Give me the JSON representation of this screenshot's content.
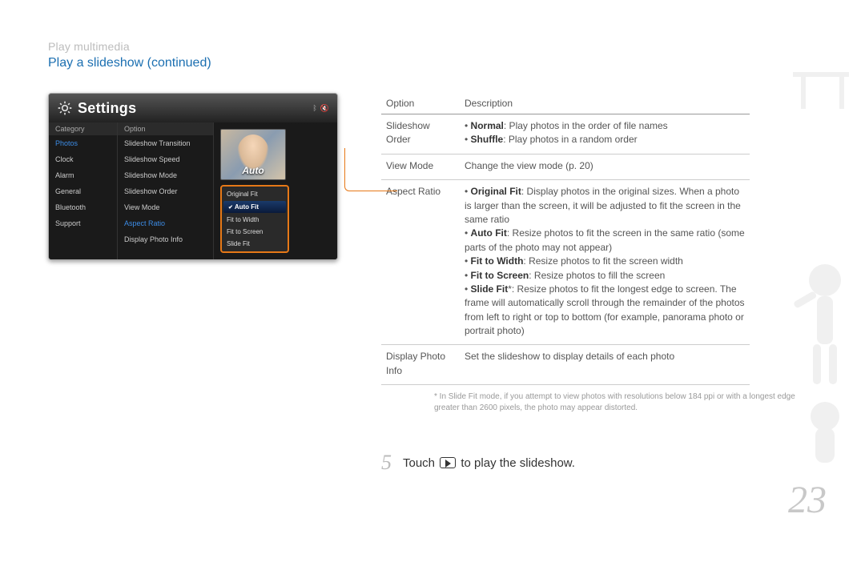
{
  "breadcrumb": "Play multimedia",
  "section_title": "Play a slideshow  (continued)",
  "settings": {
    "title": "Settings",
    "header_icons": [
      "bt-icon",
      "speaker-icon"
    ],
    "cat_heading": "Category",
    "opt_heading": "Option",
    "categories": [
      "Photos",
      "Clock",
      "Alarm",
      "General",
      "Bluetooth",
      "Support"
    ],
    "options": [
      "Slideshow Transition",
      "Slideshow Speed",
      "Slideshow Mode",
      "Slideshow Order",
      "View Mode",
      "Aspect Ratio",
      "Display Photo Info"
    ],
    "preview_label": "Auto",
    "popup": [
      "Original Fit",
      "Auto Fit",
      "Fit to Width",
      "Fit to Screen",
      "Slide Fit"
    ],
    "popup_selected": "Auto Fit"
  },
  "table": {
    "head_option": "Option",
    "head_desc": "Description",
    "rows": [
      {
        "option": "Slideshow Order",
        "items": [
          {
            "b": "Normal",
            "t": ": Play photos in the order of file names"
          },
          {
            "b": "Shuffle",
            "t": ": Play photos in a random order"
          }
        ]
      },
      {
        "option": "View Mode",
        "plain": "Change the view mode (p. 20)"
      },
      {
        "option": "Aspect Ratio",
        "items": [
          {
            "b": "Original Fit",
            "t": ": Display photos in the original sizes. When a photo is larger than the screen, it will be adjusted to fit the screen in the same ratio"
          },
          {
            "b": "Auto Fit",
            "t": ": Resize photos to fit the screen in the same ratio (some parts of the photo may not appear)"
          },
          {
            "b": "Fit to Width",
            "t": ": Resize photos to fit the screen width"
          },
          {
            "b": "Fit to Screen",
            "t": ": Resize photos to fill the screen"
          },
          {
            "b": "Slide Fit",
            "suffix": "*",
            "t": ": Resize photos to fit the longest edge to screen. The frame will automatically scroll through the remainder of the photos from left to right or top to bottom (for example, panorama photo or portrait photo)"
          }
        ]
      },
      {
        "option": "Display Photo Info",
        "plain": "Set the slideshow to display details of each photo"
      }
    ]
  },
  "footnote": "* In Slide Fit mode, if you attempt to view photos with resolutions below 184 ppi or with a longest edge greater than 2600 pixels, the photo may appear distorted.",
  "step": {
    "num": "5",
    "before": "Touch ",
    "after": " to play the slideshow."
  },
  "page_number": "23"
}
